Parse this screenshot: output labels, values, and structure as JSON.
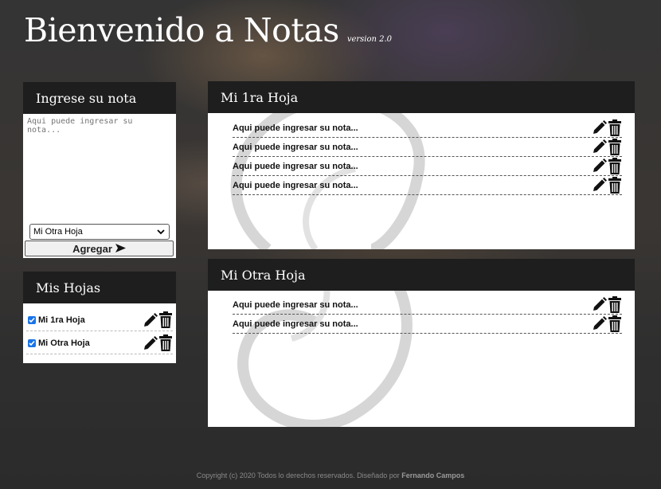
{
  "header": {
    "title": "Bienvenido a Notas",
    "version": "version 2.0"
  },
  "note_form": {
    "title": "Ingrese su nota",
    "placeholder": "Aqui puede ingresar su nota...",
    "selected_sheet": "Mi Otra Hoja",
    "add_label": "Agregar",
    "add_icon": "arrow-right-icon"
  },
  "sheets_list": {
    "title": "Mis Hojas",
    "items": [
      {
        "label": "Mi 1ra Hoja",
        "checked": true
      },
      {
        "label": "Mi Otra Hoja",
        "checked": true
      }
    ]
  },
  "sheets": [
    {
      "title": "Mi 1ra Hoja",
      "notes": [
        "Aqui puede ingresar su nota...",
        "Aqui puede ingresar su nota...",
        "Aqui puede ingresar su nota...",
        "Aqui puede ingresar su nota..."
      ]
    },
    {
      "title": "Mi Otra Hoja",
      "notes": [
        "Aqui puede ingresar su nota...",
        "Aqui puede ingresar su nota..."
      ]
    }
  ],
  "icons": {
    "edit": "pencil-icon",
    "delete": "trash-icon"
  },
  "footer": {
    "text": "Copyright (c) 2020 Todos lo derechos reservados. Diseñado por",
    "author": "Fernando Campos"
  }
}
